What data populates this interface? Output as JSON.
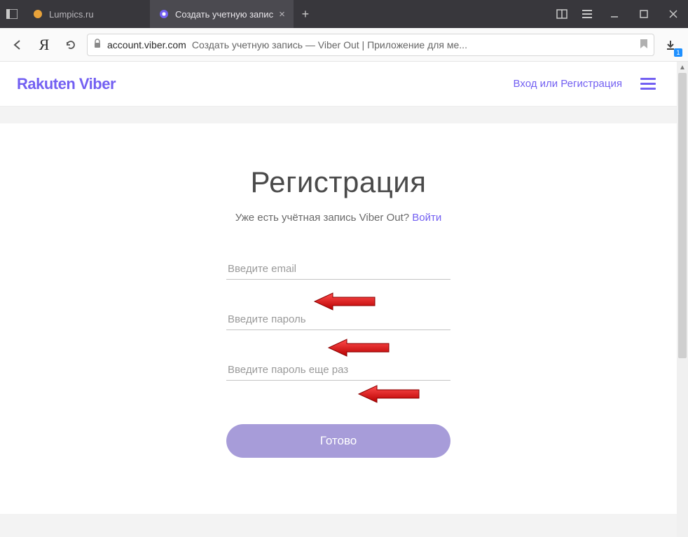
{
  "browser": {
    "tabs": [
      {
        "title": "Lumpics.ru",
        "active": false
      },
      {
        "title": "Создать учетную запис",
        "active": true
      }
    ],
    "address": {
      "domain": "account.viber.com",
      "page_title": "Создать учетную запись — Viber Out | Приложение для ме..."
    },
    "download_badge": "1"
  },
  "site_header": {
    "logo_text": "Rakuten Viber",
    "signin_link": "Вход или Регистрация"
  },
  "form": {
    "title": "Регистрация",
    "subtext": "Уже есть учётная запись Viber Out? ",
    "login_link": "Войти",
    "email_placeholder": "Введите email",
    "password_placeholder": "Введите пароль",
    "password2_placeholder": "Введите пароль еще раз",
    "submit_label": "Готово"
  }
}
